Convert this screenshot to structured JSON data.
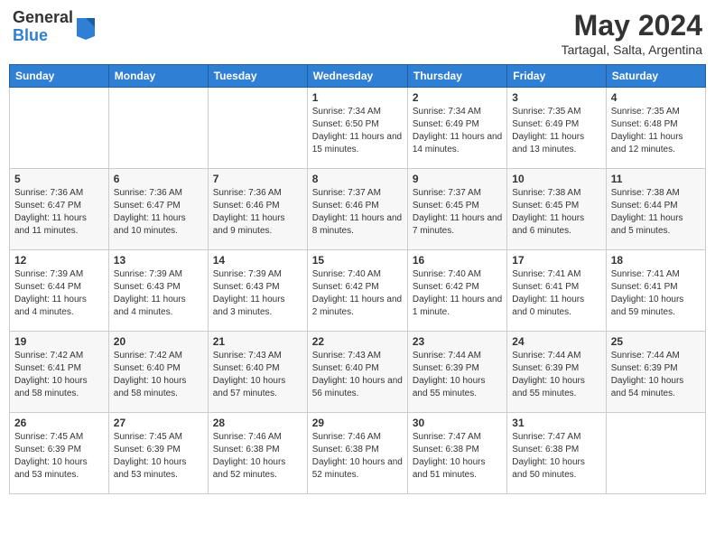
{
  "header": {
    "logo_general": "General",
    "logo_blue": "Blue",
    "month_title": "May 2024",
    "location": "Tartagal, Salta, Argentina"
  },
  "weekdays": [
    "Sunday",
    "Monday",
    "Tuesday",
    "Wednesday",
    "Thursday",
    "Friday",
    "Saturday"
  ],
  "weeks": [
    [
      {
        "day": "",
        "info": ""
      },
      {
        "day": "",
        "info": ""
      },
      {
        "day": "",
        "info": ""
      },
      {
        "day": "1",
        "info": "Sunrise: 7:34 AM\nSunset: 6:50 PM\nDaylight: 11 hours and 15 minutes."
      },
      {
        "day": "2",
        "info": "Sunrise: 7:34 AM\nSunset: 6:49 PM\nDaylight: 11 hours and 14 minutes."
      },
      {
        "day": "3",
        "info": "Sunrise: 7:35 AM\nSunset: 6:49 PM\nDaylight: 11 hours and 13 minutes."
      },
      {
        "day": "4",
        "info": "Sunrise: 7:35 AM\nSunset: 6:48 PM\nDaylight: 11 hours and 12 minutes."
      }
    ],
    [
      {
        "day": "5",
        "info": "Sunrise: 7:36 AM\nSunset: 6:47 PM\nDaylight: 11 hours and 11 minutes."
      },
      {
        "day": "6",
        "info": "Sunrise: 7:36 AM\nSunset: 6:47 PM\nDaylight: 11 hours and 10 minutes."
      },
      {
        "day": "7",
        "info": "Sunrise: 7:36 AM\nSunset: 6:46 PM\nDaylight: 11 hours and 9 minutes."
      },
      {
        "day": "8",
        "info": "Sunrise: 7:37 AM\nSunset: 6:46 PM\nDaylight: 11 hours and 8 minutes."
      },
      {
        "day": "9",
        "info": "Sunrise: 7:37 AM\nSunset: 6:45 PM\nDaylight: 11 hours and 7 minutes."
      },
      {
        "day": "10",
        "info": "Sunrise: 7:38 AM\nSunset: 6:45 PM\nDaylight: 11 hours and 6 minutes."
      },
      {
        "day": "11",
        "info": "Sunrise: 7:38 AM\nSunset: 6:44 PM\nDaylight: 11 hours and 5 minutes."
      }
    ],
    [
      {
        "day": "12",
        "info": "Sunrise: 7:39 AM\nSunset: 6:44 PM\nDaylight: 11 hours and 4 minutes."
      },
      {
        "day": "13",
        "info": "Sunrise: 7:39 AM\nSunset: 6:43 PM\nDaylight: 11 hours and 4 minutes."
      },
      {
        "day": "14",
        "info": "Sunrise: 7:39 AM\nSunset: 6:43 PM\nDaylight: 11 hours and 3 minutes."
      },
      {
        "day": "15",
        "info": "Sunrise: 7:40 AM\nSunset: 6:42 PM\nDaylight: 11 hours and 2 minutes."
      },
      {
        "day": "16",
        "info": "Sunrise: 7:40 AM\nSunset: 6:42 PM\nDaylight: 11 hours and 1 minute."
      },
      {
        "day": "17",
        "info": "Sunrise: 7:41 AM\nSunset: 6:41 PM\nDaylight: 11 hours and 0 minutes."
      },
      {
        "day": "18",
        "info": "Sunrise: 7:41 AM\nSunset: 6:41 PM\nDaylight: 10 hours and 59 minutes."
      }
    ],
    [
      {
        "day": "19",
        "info": "Sunrise: 7:42 AM\nSunset: 6:41 PM\nDaylight: 10 hours and 58 minutes."
      },
      {
        "day": "20",
        "info": "Sunrise: 7:42 AM\nSunset: 6:40 PM\nDaylight: 10 hours and 58 minutes."
      },
      {
        "day": "21",
        "info": "Sunrise: 7:43 AM\nSunset: 6:40 PM\nDaylight: 10 hours and 57 minutes."
      },
      {
        "day": "22",
        "info": "Sunrise: 7:43 AM\nSunset: 6:40 PM\nDaylight: 10 hours and 56 minutes."
      },
      {
        "day": "23",
        "info": "Sunrise: 7:44 AM\nSunset: 6:39 PM\nDaylight: 10 hours and 55 minutes."
      },
      {
        "day": "24",
        "info": "Sunrise: 7:44 AM\nSunset: 6:39 PM\nDaylight: 10 hours and 55 minutes."
      },
      {
        "day": "25",
        "info": "Sunrise: 7:44 AM\nSunset: 6:39 PM\nDaylight: 10 hours and 54 minutes."
      }
    ],
    [
      {
        "day": "26",
        "info": "Sunrise: 7:45 AM\nSunset: 6:39 PM\nDaylight: 10 hours and 53 minutes."
      },
      {
        "day": "27",
        "info": "Sunrise: 7:45 AM\nSunset: 6:39 PM\nDaylight: 10 hours and 53 minutes."
      },
      {
        "day": "28",
        "info": "Sunrise: 7:46 AM\nSunset: 6:38 PM\nDaylight: 10 hours and 52 minutes."
      },
      {
        "day": "29",
        "info": "Sunrise: 7:46 AM\nSunset: 6:38 PM\nDaylight: 10 hours and 52 minutes."
      },
      {
        "day": "30",
        "info": "Sunrise: 7:47 AM\nSunset: 6:38 PM\nDaylight: 10 hours and 51 minutes."
      },
      {
        "day": "31",
        "info": "Sunrise: 7:47 AM\nSunset: 6:38 PM\nDaylight: 10 hours and 50 minutes."
      },
      {
        "day": "",
        "info": ""
      }
    ]
  ]
}
